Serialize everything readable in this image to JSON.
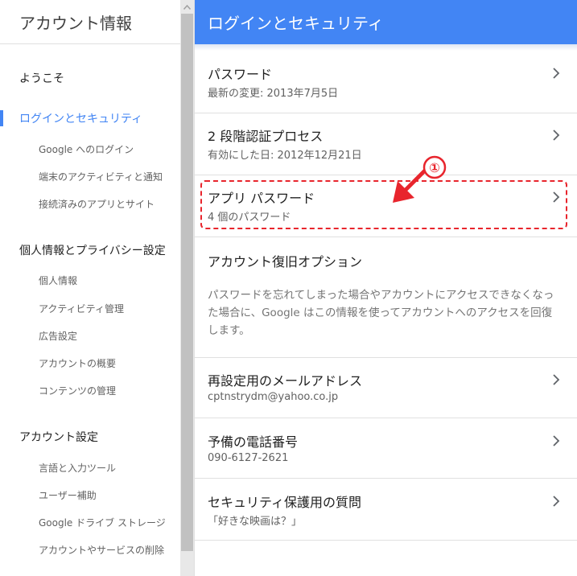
{
  "sidebar": {
    "title": "アカウント情報",
    "welcome": "ようこそ",
    "sections": [
      {
        "label": "ログインとセキュリティ",
        "items": [
          "Google へのログイン",
          "端末のアクティビティと通知",
          "接続済みのアプリとサイト"
        ]
      },
      {
        "label": "個人情報とプライバシー設定",
        "items": [
          "個人情報",
          "アクティビティ管理",
          "広告設定",
          "アカウントの概要",
          "コンテンツの管理"
        ]
      },
      {
        "label": "アカウント設定",
        "items": [
          "言語と入力ツール",
          "ユーザー補助",
          "Google ドライブ ストレージ",
          "アカウントやサービスの削除"
        ]
      }
    ]
  },
  "main": {
    "header": "ログインとセキュリティ",
    "rows": [
      {
        "title": "パスワード",
        "sub": "最新の変更: 2013年7月5日"
      },
      {
        "title": "2 段階認証プロセス",
        "sub": "有効にした日: 2012年12月21日"
      },
      {
        "title": "アプリ パスワード",
        "sub": "4 個のパスワード"
      }
    ],
    "recovery": {
      "title": "アカウント復旧オプション",
      "description": "パスワードを忘れてしまった場合やアカウントにアクセスできなくなった場合に、Google はこの情報を使ってアカウントへのアクセスを回復します。",
      "rows": [
        {
          "title": "再設定用のメールアドレス",
          "sub": "cptnstrydm@yahoo.co.jp"
        },
        {
          "title": "予備の電話番号",
          "sub": "090-6127-2621"
        },
        {
          "title": "セキュリティ保護用の質問",
          "sub": "「好きな映画は？」"
        }
      ]
    }
  },
  "annotation": {
    "marker": "①",
    "color": "#e8252d"
  },
  "colors": {
    "accent": "#4285f4",
    "annotation": "#e8252d"
  }
}
